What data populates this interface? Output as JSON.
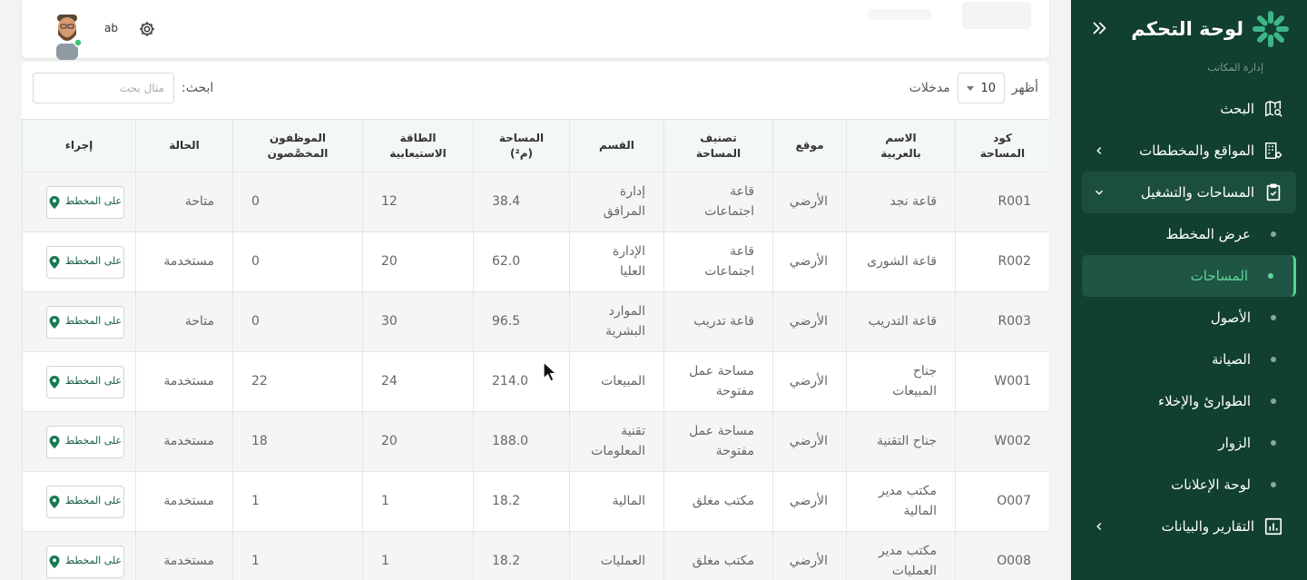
{
  "sidebar": {
    "brand_title": "لوحة التحكم",
    "section_caption": "إدارة المكاتب",
    "nav": [
      {
        "label": "البحث",
        "icon": "map-search-icon"
      },
      {
        "label": "المواقع والمخططات",
        "icon": "building-gear-icon"
      },
      {
        "label": "المساحات والتشغيل",
        "icon": "clipboard-check-icon"
      }
    ],
    "sub_items": [
      "عرض المخطط",
      "المساحات",
      "الأصول",
      "الصيانة",
      "الطوارئ والإخلاء",
      "الزوار",
      "لوحة الإعلانات"
    ],
    "reports": {
      "label": "التقارير والبيانات",
      "icon": "bar-chart-icon"
    },
    "active_sub": "المساحات"
  },
  "header": {
    "user_initials": "ab"
  },
  "table_controls": {
    "show_label": "أظهر",
    "page_length": "10",
    "entries_label": "مدخلات",
    "search_label": "ابحث:",
    "search_placeholder": "مثال بحث"
  },
  "columns": [
    "كود المساحة",
    "الاسم بالعربية",
    "موقع",
    "تصنيف المساحة",
    "القسم",
    "المساحة (م²)",
    "الطاقة الاستيعابية",
    "الموظفون المخصَّصون",
    "الحالة",
    "إجراء"
  ],
  "rows": [
    {
      "code": "R001",
      "name": "قاعة نجد",
      "location": "الأرضي",
      "type": "قاعة اجتماعات",
      "dept": "إدارة المرافق",
      "area": "38.4",
      "capacity": "12",
      "staff": "0",
      "status": "متاحة",
      "action": "على المخطط"
    },
    {
      "code": "R002",
      "name": "قاعة الشورى",
      "location": "الأرضي",
      "type": "قاعة اجتماعات",
      "dept": "الإدارة العليا",
      "area": "62.0",
      "capacity": "20",
      "staff": "0",
      "status": "مستخدمة",
      "action": "على المخطط"
    },
    {
      "code": "R003",
      "name": "قاعة التدريب",
      "location": "الأرضي",
      "type": "قاعة تدريب",
      "dept": "الموارد البشرية",
      "area": "96.5",
      "capacity": "30",
      "staff": "0",
      "status": "متاحة",
      "action": "على المخطط"
    },
    {
      "code": "W001",
      "name": "جناح المبيعات",
      "location": "الأرضي",
      "type": "مساحة عمل مفتوحة",
      "dept": "المبيعات",
      "area": "214.0",
      "capacity": "24",
      "staff": "22",
      "status": "مستخدمة",
      "action": "على المخطط"
    },
    {
      "code": "W002",
      "name": "جناح التقنية",
      "location": "الأرضي",
      "type": "مساحة عمل مفتوحة",
      "dept": "تقنية المعلومات",
      "area": "188.0",
      "capacity": "20",
      "staff": "18",
      "status": "مستخدمة",
      "action": "على المخطط"
    },
    {
      "code": "O007",
      "name": "مكتب مدير المالية",
      "location": "الأرضي",
      "type": "مكتب مغلق",
      "dept": "المالية",
      "area": "18.2",
      "capacity": "1",
      "staff": "1",
      "status": "مستخدمة",
      "action": "على المخطط"
    },
    {
      "code": "O008",
      "name": "مكتب مدير العمليات",
      "location": "الأرضي",
      "type": "مكتب مغلق",
      "dept": "العمليات",
      "area": "18.2",
      "capacity": "1",
      "staff": "1",
      "status": "مستخدمة",
      "action": "على المخطط"
    }
  ],
  "colors": {
    "sidebar_bg": "#113f32",
    "accent": "#4fd592",
    "primary_text": "#1a5e45"
  }
}
